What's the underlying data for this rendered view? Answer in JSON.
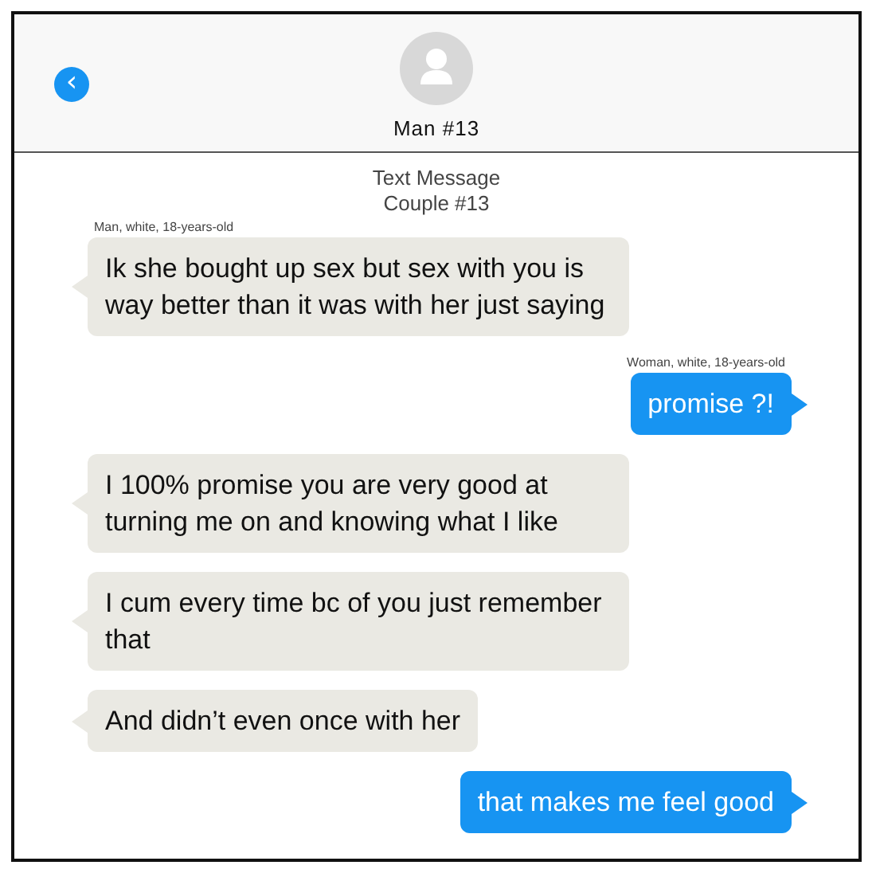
{
  "header": {
    "back_button": "‹",
    "contact_name": "Man #13"
  },
  "title_lines": [
    "Text Message",
    "Couple #13"
  ],
  "messages": [
    {
      "kind": "received",
      "sender": "Man, white, 18-years-old",
      "text": "Ik she bought up sex but sex with you is way better than it was with her just saying"
    },
    {
      "kind": "sent",
      "sender": "Woman, white, 18-years-old",
      "text": "promise ?!"
    },
    {
      "kind": "received",
      "text": "I 100% promise you are very good at turning me on and knowing what I like"
    },
    {
      "kind": "received",
      "text": "I cum every time bc of you just remember that"
    },
    {
      "kind": "received",
      "text": "And didn’t even once with her"
    },
    {
      "kind": "sent",
      "text": "that makes me feel good"
    }
  ]
}
